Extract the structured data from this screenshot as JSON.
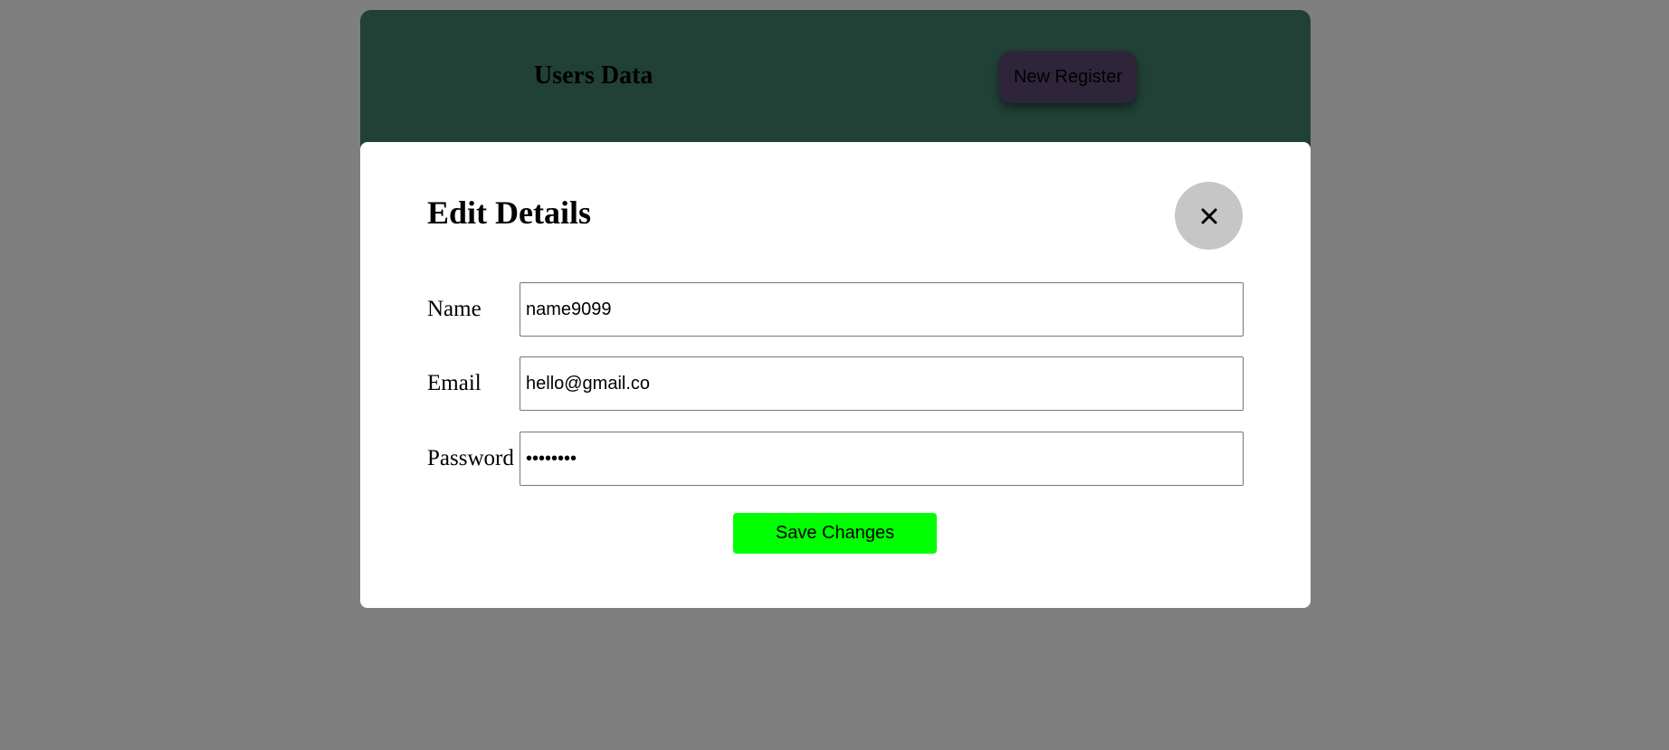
{
  "header": {
    "title": "Users Data",
    "new_register_label": "New Register"
  },
  "modal": {
    "title": "Edit Details",
    "close_icon": "close-icon",
    "fields": [
      {
        "label": "Name",
        "value": "name9099",
        "type": "text"
      },
      {
        "label": "Email",
        "value": "hello@gmail.co",
        "type": "text"
      },
      {
        "label": "Password",
        "value": "password",
        "type": "password"
      }
    ],
    "save_label": "Save Changes"
  },
  "colors": {
    "header_bg": "#43826c",
    "new_register_bg": "#5c4a74",
    "overlay": "rgba(0,0,0,0.5)",
    "close_bg": "#c6c6c6",
    "save_bg": "#00ff00"
  }
}
